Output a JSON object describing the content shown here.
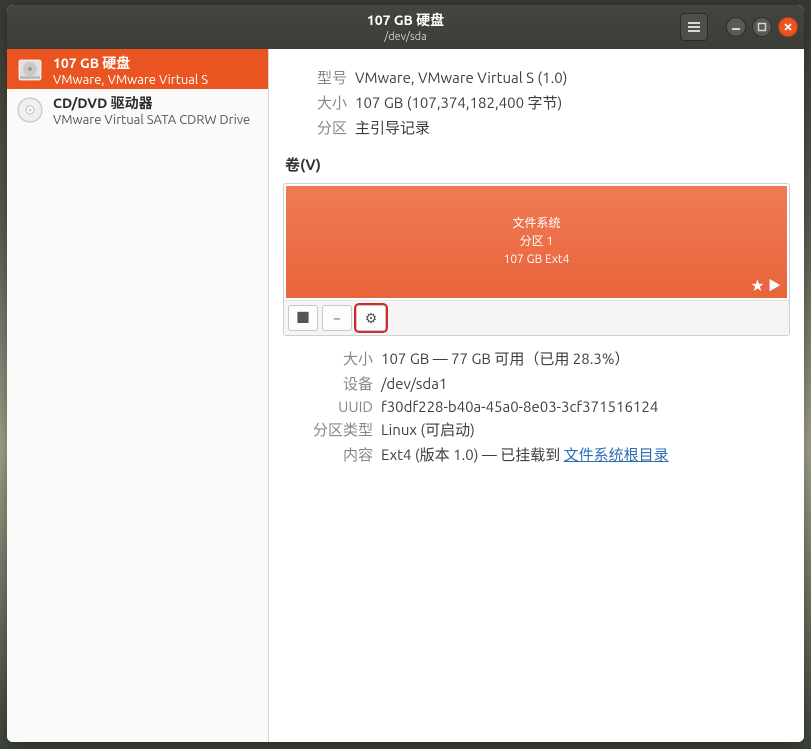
{
  "titlebar": {
    "title": "107 GB 硬盘",
    "subtitle": "/dev/sda"
  },
  "colors": {
    "accent": "#e95420"
  },
  "sidebar": {
    "devices": [
      {
        "name": "107 GB 硬盘",
        "sub": "VMware, VMware Virtual S",
        "selected": true,
        "icon": "hdd-icon"
      },
      {
        "name": "CD/DVD 驱动器",
        "sub": "VMware Virtual SATA CDRW Drive",
        "selected": false,
        "icon": "optical-icon"
      }
    ]
  },
  "model": {
    "label": "型号",
    "value": "VMware, VMware Virtual S (1.0)"
  },
  "size": {
    "label": "大小",
    "value": "107 GB (107,374,182,400 字节)"
  },
  "partitioning": {
    "label": "分区",
    "value": "主引导记录"
  },
  "volumes_header": "卷(V)",
  "partition": {
    "line1": "文件系统",
    "line2": "分区 1",
    "line3": "107 GB Ext4"
  },
  "toolbar": {
    "unmount": "■",
    "minus": "−",
    "gear": "⚙"
  },
  "details": {
    "size": {
      "label": "大小",
      "value": "107 GB — 77 GB 可用（已用 28.3%）"
    },
    "device": {
      "label": "设备",
      "value": "/dev/sda1"
    },
    "uuid": {
      "label": "UUID",
      "value": "f30df228-b40a-45a0-8e03-3cf371516124"
    },
    "ptype": {
      "label": "分区类型",
      "value": "Linux (可启动)"
    },
    "content": {
      "label": "内容",
      "prefix": "Ext4 (版本 1.0) — 已挂载到 ",
      "link": "文件系统根目录"
    }
  }
}
